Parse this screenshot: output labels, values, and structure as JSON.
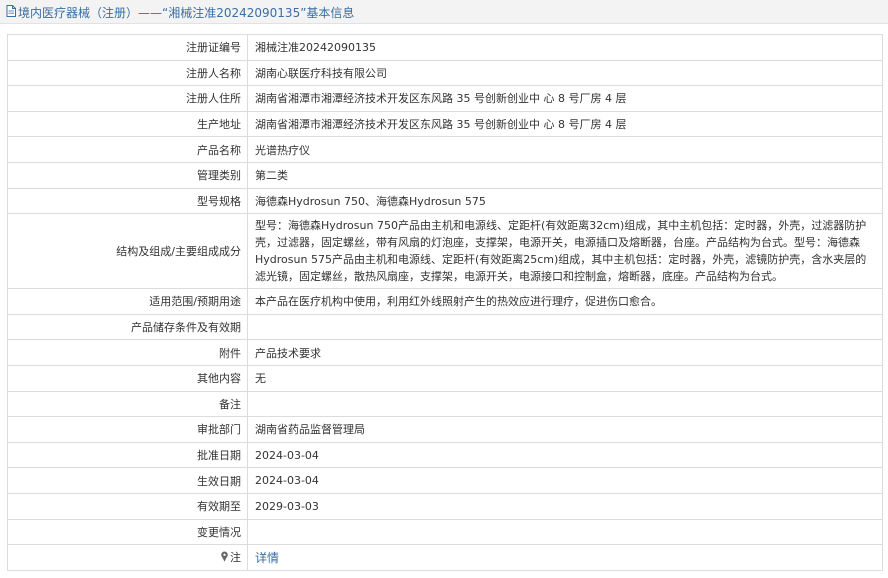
{
  "header": {
    "title": "境内医疗器械（注册）——“湘械注准20242090135”基本信息",
    "icon": "document-icon"
  },
  "rows": [
    {
      "label": "注册证编号",
      "value": "湘械注准20242090135"
    },
    {
      "label": "注册人名称",
      "value": "湖南心联医疗科技有限公司"
    },
    {
      "label": "注册人住所",
      "value": "湖南省湘潭市湘潭经济技术开发区东风路 35 号创新创业中 心 8 号厂房 4 层"
    },
    {
      "label": "生产地址",
      "value": "湖南省湘潭市湘潭经济技术开发区东风路 35 号创新创业中 心 8 号厂房 4 层"
    },
    {
      "label": "产品名称",
      "value": "光谱热疗仪"
    },
    {
      "label": "管理类别",
      "value": "第二类"
    },
    {
      "label": "型号规格",
      "value": "海德森Hydrosun 750、海德森Hydrosun 575"
    },
    {
      "label": "结构及组成/主要组成成分",
      "value": "型号：海德森Hydrosun 750产品由主机和电源线、定距杆(有效距离32cm)组成，其中主机包括：定时器，外壳，过滤器防护壳，过滤器，固定螺丝，带有风扇的灯泡座，支撑架，电源开关，电源插口及熔断器，台座。产品结构为台式。型号：海德森Hydrosun 575产品由主机和电源线、定距杆(有效距离25cm)组成，其中主机包括：定时器，外壳，滤镜防护壳，含水夹层的滤光镜，固定螺丝，散热风扇座，支撑架，电源开关，电源接口和控制盒，熔断器，底座。产品结构为台式。"
    },
    {
      "label": "适用范围/预期用途",
      "value": "本产品在医疗机构中使用，利用红外线照射产生的热效应进行理疗，促进伤口愈合。"
    },
    {
      "label": "产品储存条件及有效期",
      "value": ""
    },
    {
      "label": "附件",
      "value": "产品技术要求"
    },
    {
      "label": "其他内容",
      "value": "无"
    },
    {
      "label": "备注",
      "value": ""
    },
    {
      "label": "审批部门",
      "value": "湖南省药品监督管理局"
    },
    {
      "label": "批准日期",
      "value": "2024-03-04"
    },
    {
      "label": "生效日期",
      "value": "2024-03-04"
    },
    {
      "label": "有效期至",
      "value": "2029-03-03"
    },
    {
      "label": "变更情况",
      "value": ""
    }
  ],
  "note_row": {
    "label": "注",
    "icon": "pin-icon",
    "link_text": "详情"
  },
  "colors": {
    "header_bg": "#f3f3f3",
    "title_color": "#3a6ea5",
    "border": "#dcdcdc",
    "link": "#3a6ea5"
  }
}
